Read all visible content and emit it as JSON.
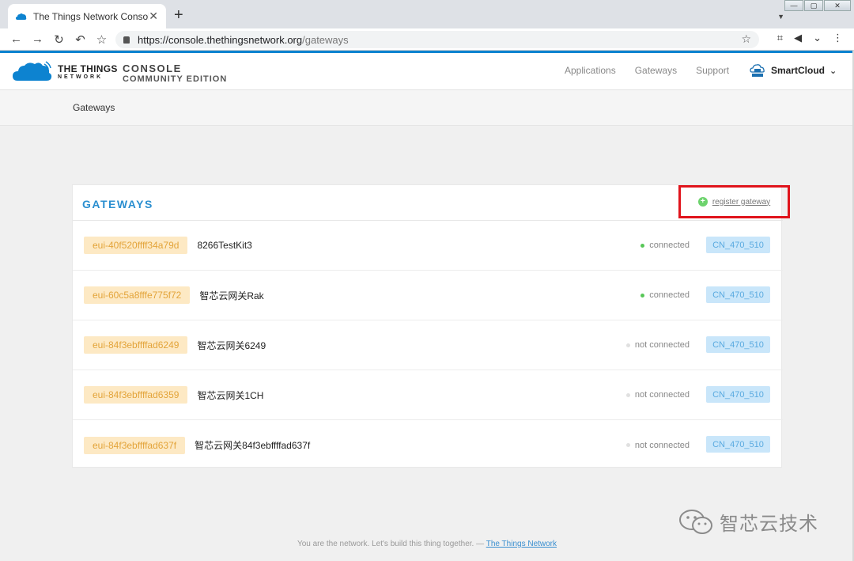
{
  "browser": {
    "tab_title": "The Things Network Console",
    "tab_close": "✕",
    "new_tab": "+",
    "url_base": "https://console.thethingsnetwork.org",
    "url_path": "/gateways",
    "window_controls": {
      "minimize": "—",
      "maximize": "▢",
      "close": "✕"
    }
  },
  "header": {
    "brand_line1": "THE THINGS",
    "brand_line2": "NETWORK",
    "console_line1": "CONSOLE",
    "console_line2": "COMMUNITY EDITION",
    "nav": [
      "Applications",
      "Gateways",
      "Support"
    ],
    "user_name": "SmartCloud"
  },
  "breadcrumb": {
    "current": "Gateways"
  },
  "gateways": {
    "title": "GATEWAYS",
    "register_label": "register gateway",
    "rows": [
      {
        "eui": "eui-40f520ffff34a79d",
        "name": "8266TestKit3",
        "status": "connected",
        "frequency_plan": "CN_470_510"
      },
      {
        "eui": "eui-60c5a8fffe775f72",
        "name": "智芯云网关Rak",
        "status": "connected",
        "frequency_plan": "CN_470_510"
      },
      {
        "eui": "eui-84f3ebffffad6249",
        "name": "智芯云网关6249",
        "status": "not connected",
        "frequency_plan": "CN_470_510"
      },
      {
        "eui": "eui-84f3ebffffad6359",
        "name": "智芯云网关1CH",
        "status": "not connected",
        "frequency_plan": "CN_470_510"
      },
      {
        "eui": "eui-84f3ebffffad637f",
        "name": "智芯云网关84f3ebffffad637f",
        "status": "not connected",
        "frequency_plan": "CN_470_510"
      }
    ]
  },
  "footer": {
    "text": "You are the network. Let's build this thing together. —",
    "link": "The Things Network"
  },
  "watermark": {
    "text": "智芯云技术"
  },
  "colors": {
    "accent": "#2b8fd0",
    "highlight_box": "#e0141c",
    "connected": "#58c758",
    "eui_bg": "#fde9c4",
    "freq_bg": "#c9e6fa"
  }
}
